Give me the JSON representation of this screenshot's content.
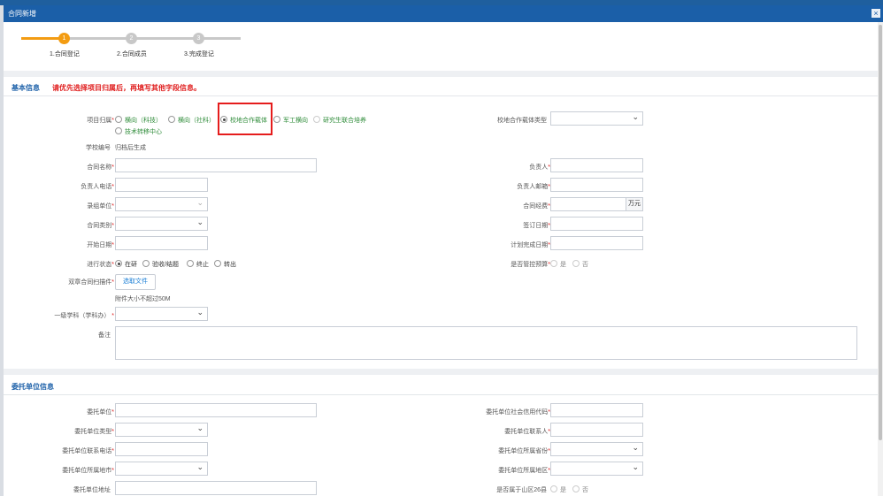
{
  "window": {
    "title": "合同新增",
    "close_glyph": "×"
  },
  "steps": [
    {
      "num": "1",
      "label": "1.合同登记"
    },
    {
      "num": "2",
      "label": "2.合同成员"
    },
    {
      "num": "3",
      "label": "3.完成登记"
    }
  ],
  "basic": {
    "heading": "基本信息",
    "warning": "请优先选择项目归属后，再填写其他字段信息。",
    "project_type_label": "项目归属",
    "project_type_options": [
      "横向（科技）",
      "横向（社科）",
      "校地合作载体",
      "军工横向",
      "研究生联合培养",
      "技术转移中心"
    ],
    "carrier_type_label": "校地合作载体类型",
    "school_code_label": "学校编号",
    "school_code_value": "归档后生成",
    "contract_name_label": "合同名称",
    "leader_label": "负责人",
    "leader_phone_label": "负责人电话",
    "leader_email_label": "负责人邮箱",
    "dept_label": "录组单位",
    "funding_label": "合同经费",
    "funding_unit": "万元",
    "category_label": "合同类别",
    "sign_date_label": "签订日期",
    "start_date_label": "开始日期",
    "plan_end_label": "计划完成日期",
    "progress_label": "进行状态",
    "progress_options": [
      "在研",
      "验收/结题",
      "终止",
      "转出"
    ],
    "budget_label": "是否管控预算",
    "yes": "是",
    "no": "否",
    "scan_label": "双章合同扫描件",
    "choose_file": "选取文件",
    "file_hint": "附件大小不超过50M",
    "discipline_label": "一级学科（学科办）",
    "remark_label": "备注"
  },
  "client": {
    "heading": "委托单位信息",
    "unit_label": "委托单位",
    "credit_code_label": "委托单位社会信用代码",
    "unit_type_label": "委托单位类型",
    "contact_label": "委托单位联系人",
    "contact_phone_label": "委托单位联系电话",
    "province_label": "委托单位所属省份",
    "city_label": "委托单位所属地市",
    "district_label": "委托单位所属地区",
    "address_label": "委托单位地址",
    "mountain_label": "是否属于山区26县",
    "yes": "是",
    "no": "否"
  },
  "colors": {
    "title_bar": "#1b5fa8",
    "step_active": "#f39c12",
    "step_inactive": "#c8c8c8",
    "required": "#e02020",
    "highlight": "#e51c1c"
  }
}
